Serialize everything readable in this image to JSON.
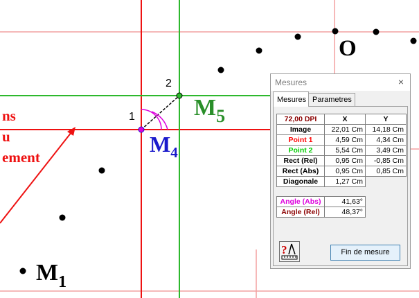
{
  "figure": {
    "labels": {
      "o": "O",
      "m5": "M",
      "m5_sub": "5",
      "m4": "M",
      "m4_sub": "4",
      "m1": "M",
      "m1_sub": "1",
      "pt1": "1",
      "pt2": "2"
    },
    "red_text": [
      "ns",
      "u",
      "ement"
    ],
    "colors": {
      "red": "#ee1111",
      "green": "#2db82d",
      "blue": "#1a1acc",
      "magenta": "#dd00dd",
      "pink_grid": "#f2a0a0"
    }
  },
  "dialog": {
    "title": "Mesures",
    "close": "×",
    "tabs": [
      "Mesures",
      "Parametres"
    ],
    "table": {
      "header": {
        "dpi": "72,00 DPI",
        "x": "X",
        "y": "Y"
      },
      "rows": [
        {
          "label": "Image",
          "x": "22,01 Cm",
          "y": "14,18 Cm"
        },
        {
          "label": "Point 1",
          "x": "4,59 Cm",
          "y": "4,34 Cm"
        },
        {
          "label": "Point 2",
          "x": "5,54 Cm",
          "y": "3,49 Cm"
        },
        {
          "label": "Rect (Rel)",
          "x": "0,95 Cm",
          "y": "-0,85 Cm"
        },
        {
          "label": "Rect (Abs)",
          "x": "0,95 Cm",
          "y": "0,85 Cm"
        },
        {
          "label": "Diagonale",
          "x": "1,27 Cm"
        }
      ]
    },
    "angles": [
      {
        "label": "Angle (Abs)",
        "value": "41,63°"
      },
      {
        "label": "Angle (Rel)",
        "value": "48,37°"
      }
    ],
    "help_icon": "ruler-help-icon",
    "button": "Fin de mesure"
  }
}
